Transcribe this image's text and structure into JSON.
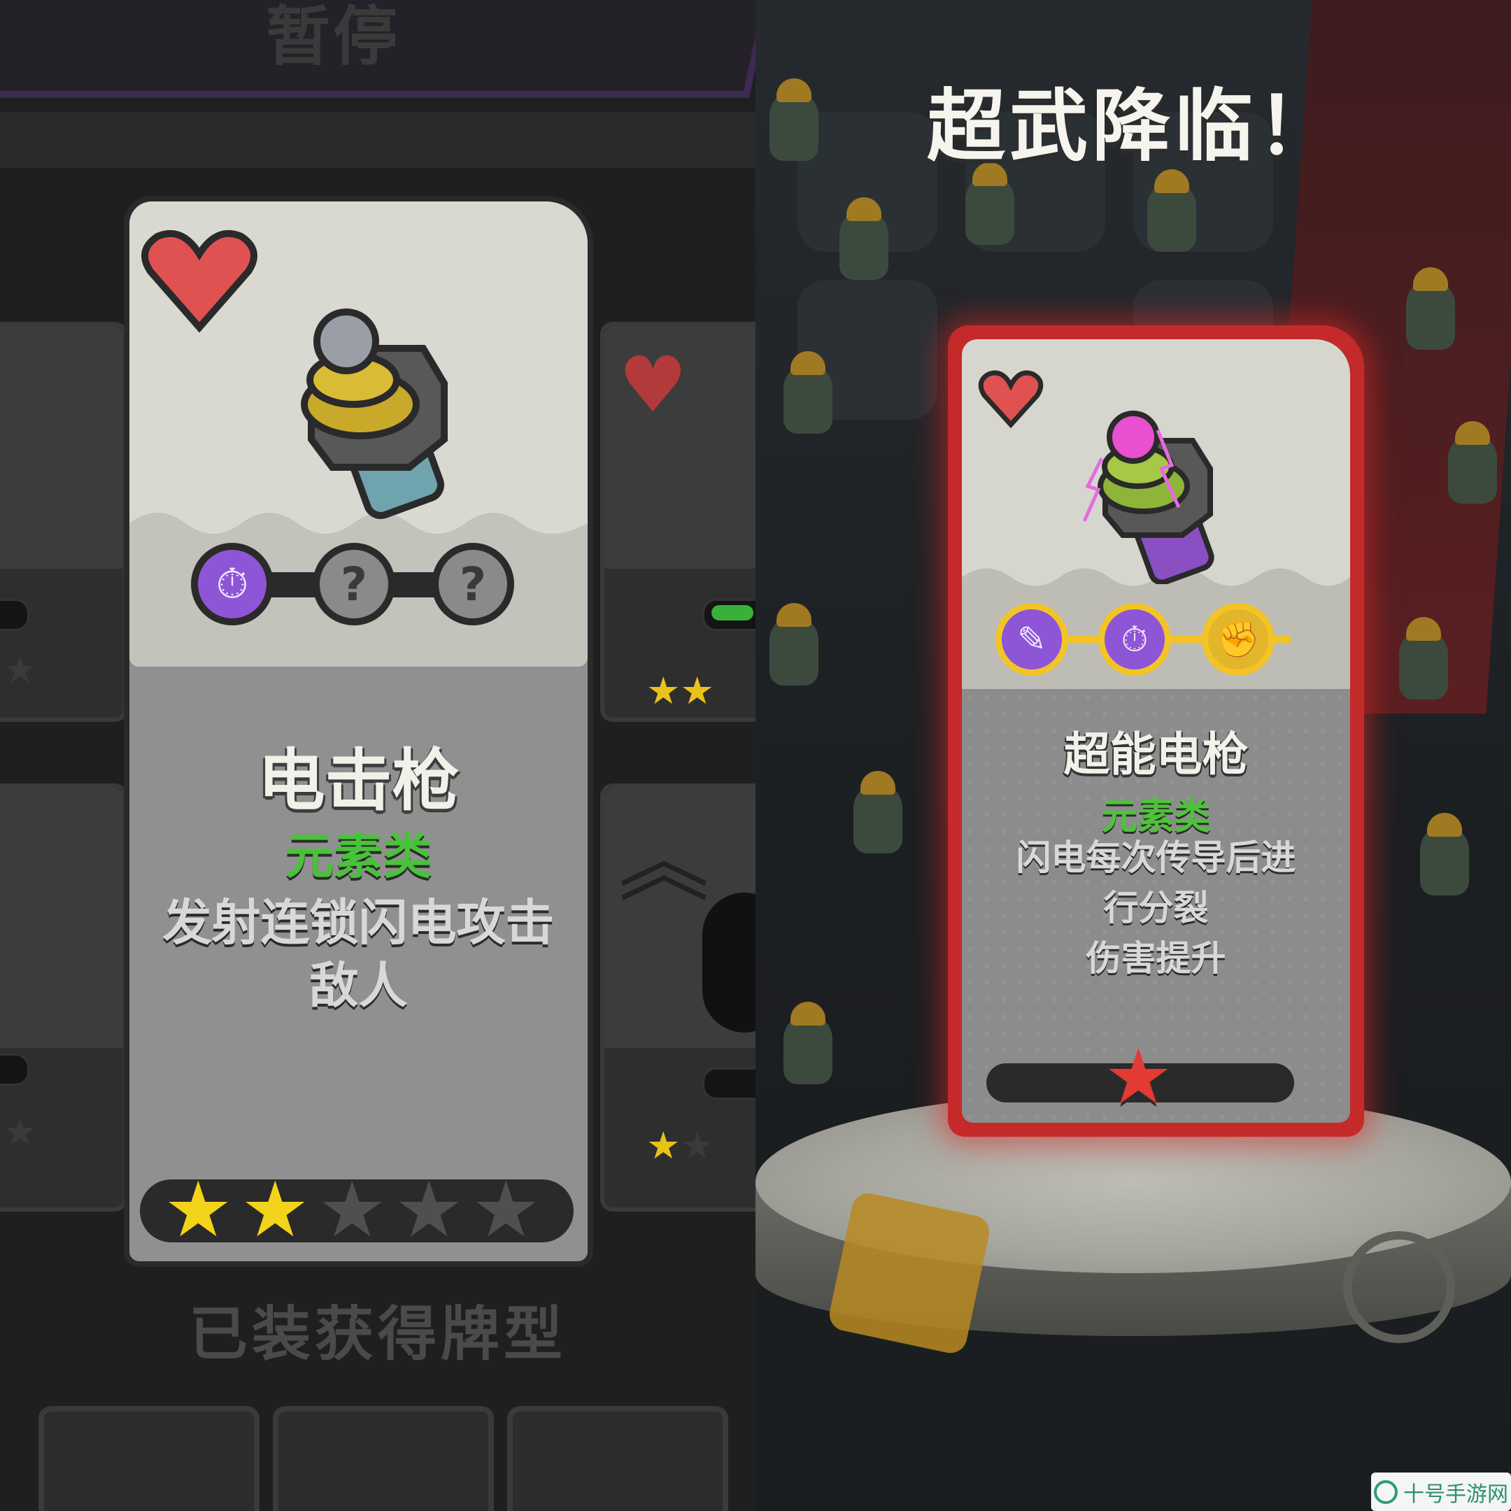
{
  "left_panel": {
    "header": {
      "title": "暂停"
    },
    "featured_card": {
      "name": "电击枪",
      "category": "元素类",
      "description_lines": [
        "发射连锁闪电攻击",
        "敌人"
      ],
      "slots": [
        "stopwatch",
        "?",
        "?"
      ],
      "rating": {
        "filled": 2,
        "total": 5
      }
    },
    "section_title": "已装获得牌型"
  },
  "right_panel": {
    "title": "超武降临！",
    "card": {
      "name": "超能电枪",
      "category": "元素类",
      "description_lines": [
        "闪电每次传导后进",
        "行分裂",
        "伤害提升"
      ],
      "slots": [
        "bullet",
        "stopwatch",
        "fist"
      ],
      "rating": {
        "filled": 1
      }
    }
  },
  "watermark": {
    "text": "十号手游网"
  },
  "colors": {
    "accent_green": "#49c23b",
    "star_gold": "#f3d31a",
    "card_frame_red": "#c42a2a",
    "slot_purple": "#8e55d6"
  },
  "icons": {
    "heart": "heart-icon",
    "star": "star-icon",
    "question": "?"
  }
}
